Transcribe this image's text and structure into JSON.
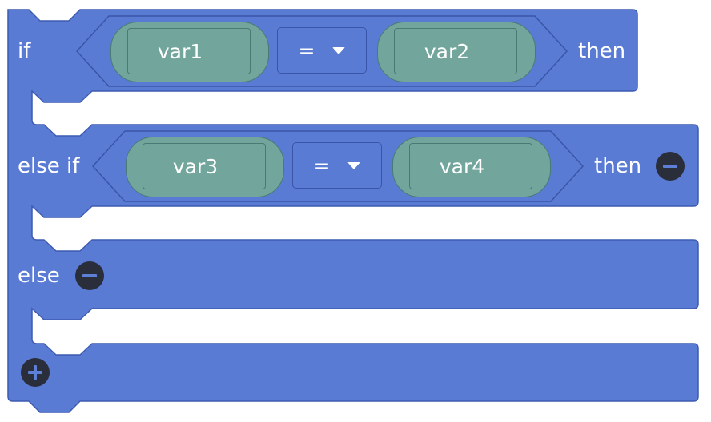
{
  "colors": {
    "block_fill": "#5a7bd4",
    "block_stroke": "#3d5bb0",
    "inner_fill": "#5a7bd4",
    "variable_fill": "#72a59c",
    "button_fill": "#2a2d3a",
    "text": "#ffffff"
  },
  "branches": {
    "if": {
      "keyword": "if",
      "left_var": "var1",
      "operator": "=",
      "right_var": "var2",
      "then_label": "then"
    },
    "else_if": {
      "keyword": "else if",
      "left_var": "var3",
      "operator": "=",
      "right_var": "var4",
      "then_label": "then",
      "remove_icon": "minus-icon"
    },
    "else": {
      "keyword": "else",
      "remove_icon": "minus-icon"
    }
  },
  "footer": {
    "add_icon": "plus-icon"
  }
}
